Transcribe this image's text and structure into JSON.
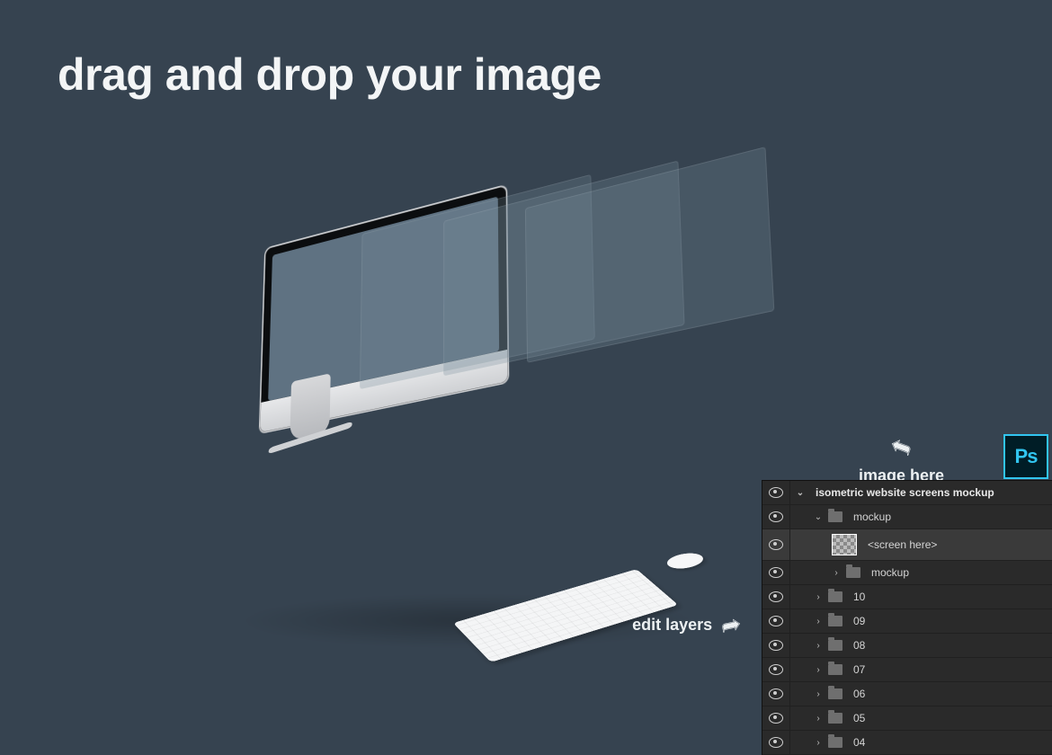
{
  "headline": "drag and drop your image",
  "annotations": {
    "image_here": "image here",
    "edit_layers": "edit layers"
  },
  "ps_badge": "Ps",
  "layers_panel": {
    "root": {
      "label": "isometric website screens mockup",
      "open": true
    },
    "mockup_group": {
      "label": "mockup",
      "open": true
    },
    "screen_here": {
      "label": "<screen here>"
    },
    "nested_mockup": {
      "label": "mockup",
      "open": false
    },
    "numbered": [
      {
        "label": "10"
      },
      {
        "label": "09"
      },
      {
        "label": "08"
      },
      {
        "label": "07"
      },
      {
        "label": "06"
      },
      {
        "label": "05"
      },
      {
        "label": "04"
      }
    ]
  }
}
